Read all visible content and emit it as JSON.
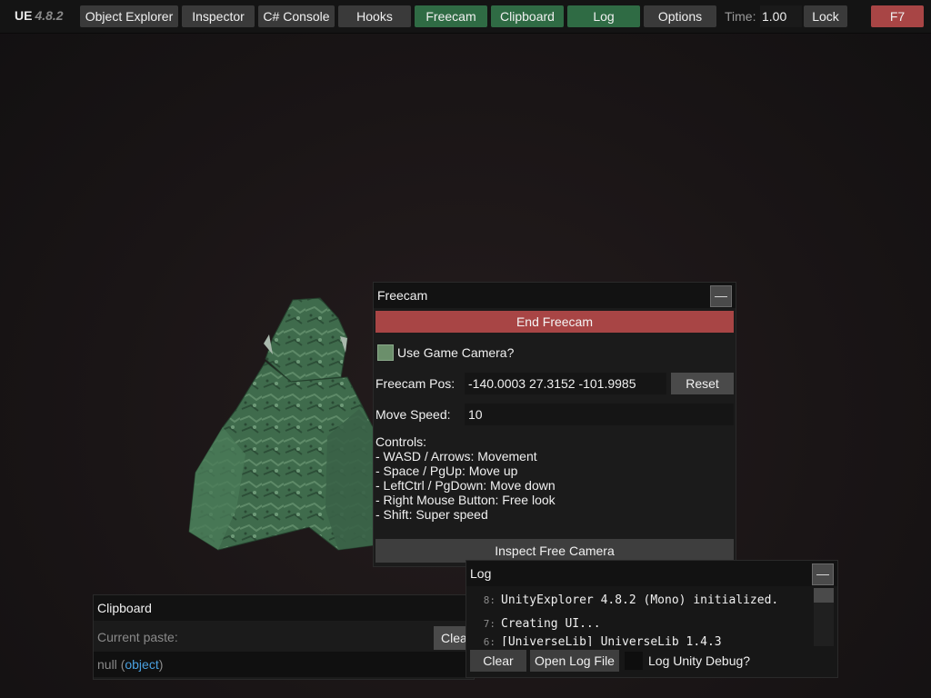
{
  "topbar": {
    "brand": "UE",
    "version": "4.8.2",
    "buttons": {
      "object_explorer": "Object Explorer",
      "inspector": "Inspector",
      "csharp_console": "C# Console",
      "hooks": "Hooks",
      "freecam": "Freecam",
      "clipboard": "Clipboard",
      "log": "Log",
      "options": "Options",
      "lock": "Lock",
      "f7": "F7"
    },
    "active_tabs": [
      "Freecam",
      "Clipboard",
      "Log"
    ],
    "time_label": "Time:",
    "time_value": "1.00"
  },
  "freecam": {
    "title": "Freecam",
    "minimize": "—",
    "end_button": "End Freecam",
    "use_game_camera_label": "Use Game Camera?",
    "use_game_camera_checked": true,
    "pos_label": "Freecam Pos:",
    "pos_value": "-140.0003 27.3152 -101.9985",
    "reset_button": "Reset",
    "speed_label": "Move Speed:",
    "speed_value": "10",
    "controls": [
      "Controls:",
      "- WASD / Arrows: Movement",
      "- Space / PgUp: Move up",
      "- LeftCtrl / PgDown: Move down",
      "- Right Mouse Button: Free look",
      "- Shift: Super speed"
    ],
    "inspect_button": "Inspect Free Camera"
  },
  "clipboard": {
    "title": "Clipboard",
    "current_paste_label": "Current paste:",
    "clear_button": "Clear",
    "value_null": "null",
    "value_paren_open": "(",
    "value_type": "object",
    "value_paren_close": ")"
  },
  "log": {
    "title": "Log",
    "minimize": "—",
    "lines": [
      {
        "num": "8:",
        "text": "UnityExplorer 4.8.2 (Mono) initialized."
      },
      {
        "num": "7:",
        "text": "Creating UI..."
      },
      {
        "num": "6:",
        "text": "[UniverseLib] UniverseLib 1.4.3"
      }
    ],
    "clear_button": "Clear",
    "open_log_button": "Open Log File",
    "debug_label": "Log Unity Debug?",
    "debug_checked": false
  },
  "colors": {
    "active_tab": "#2f6b44",
    "danger": "#a84545",
    "button": "#3a3a3a",
    "link": "#4aa0e0"
  }
}
